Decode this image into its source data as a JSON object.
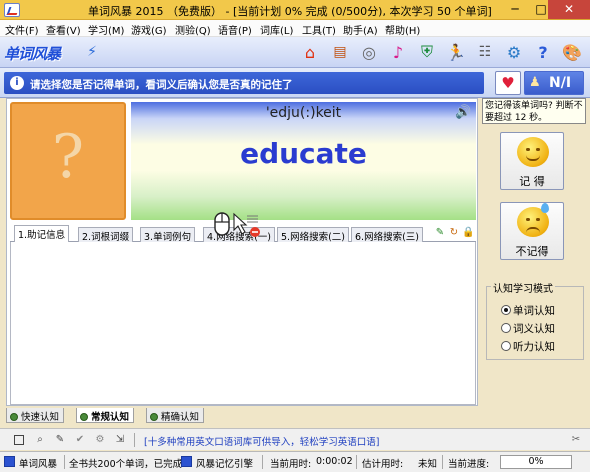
{
  "window": {
    "title": "单词风暴 2015 （免费版） - [当前计划 0% 完成 (0/500分), 本次学习 50 个单词]",
    "minimize": "─",
    "maximize": "□",
    "close": "✕"
  },
  "menu": [
    "文件(F)",
    "查看(V)",
    "学习(M)",
    "游戏(G)",
    "测验(Q)",
    "语音(P)",
    "词库(L)",
    "工具(T)",
    "助手(A)",
    "帮助(H)"
  ],
  "toolbar": {
    "logo": "单词风暴",
    "icons": [
      "home-icon",
      "book-icon",
      "cd-icon",
      "music-icon",
      "shield-icon",
      "runner-icon",
      "list-icon",
      "gear-icon",
      "help-icon",
      "palette-icon"
    ]
  },
  "prompt": {
    "text": "请选择您是否记得单词，看词义后确认您是否真的记住了",
    "info": "i",
    "next_label": "N/I"
  },
  "card": {
    "question_mark": "?",
    "phonetic": "'edju(:)keit",
    "word": "educate"
  },
  "tabs": [
    "1.助记信息",
    "2.词根词缀",
    "3.单词例句",
    "4.网络搜索(一)",
    "5.网络搜索(二)",
    "6.网络搜索(三)"
  ],
  "side": {
    "question": "您记得该单词吗? 判断不要超过 12 秒。",
    "know_label": "记 得",
    "dontknow_label": "不记得",
    "mode_title": "认知学习模式",
    "modes": [
      "单词认知",
      "词义认知",
      "听力认知"
    ],
    "selected_mode": 0
  },
  "mode_tabs": [
    "快速认知",
    "常规认知",
    "精确认知"
  ],
  "active_mode_tab": 1,
  "tip": "[十多种常用英文口语词库可供导入，轻松学习英语口语]",
  "status": {
    "app": "单词风暴",
    "summary": "全书共200个单词，已完成",
    "engine": "风暴记忆引擎",
    "time_label": "当前用时:",
    "time_value": "0:00:02",
    "estimate_label": "估计用时:",
    "estimate_value": "未知",
    "progress_label": "当前进度:",
    "progress_value": "0%",
    "progress_fraction": 0
  },
  "colors": {
    "titlebar": "#f2c84a",
    "prompt_bar": "#2a4ec2",
    "word": "#2a3cd0",
    "question_box": "#f2a54a"
  }
}
